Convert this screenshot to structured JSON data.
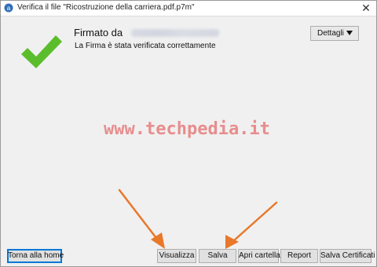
{
  "window": {
    "title": "Verifica il file \"Ricostruzione della carriera.pdf.p7m\"",
    "close_glyph": "✕",
    "app_icon": "app-logo-icon"
  },
  "status": {
    "icon": "checkmark-icon",
    "icon_color": "#5bbd2b",
    "signer_label": "Firmato da",
    "signer_name_redacted": true,
    "message": "La Firma è stata verificata correttamente"
  },
  "details": {
    "label": "Dettagli",
    "icon": "caret-down-icon"
  },
  "watermark": {
    "text": "www.techpedia.it",
    "color": "#e13c3c"
  },
  "annotations": {
    "arrow_color": "#e8782a",
    "icon": "arrow-icon"
  },
  "buttons": {
    "home": "Torna alla home",
    "view": "Visualizza",
    "save": "Salva",
    "open_folder": "Apri cartella",
    "report": "Report",
    "save_certificate": "Salva Certificati"
  }
}
